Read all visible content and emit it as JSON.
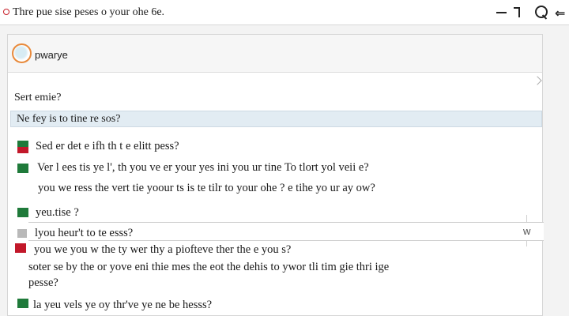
{
  "window": {
    "title": "Thre pue sise peses o your ohe 6e."
  },
  "app": {
    "name": "pwarye"
  },
  "prompt": {
    "text": "Sert emie?"
  },
  "search": {
    "text": "Ne fey is to tine re sos?"
  },
  "messages": [
    {
      "lines": [
        "Sed er det e ifh th t e elitt pess?"
      ]
    },
    {
      "lines": [
        "Ver l ees tis ye l',  th you ve er your yes ini you ur tine To tlort yol veii e?",
        "you we ress the vert tie yoour ts is te tilr to your ohe ? e tihe yo ur ay ow?"
      ]
    },
    {
      "lines": [
        "yeu.tise ?"
      ]
    },
    {
      "lines": [
        "lyou heur't to te esss?"
      ]
    },
    {
      "lines": [
        "you we you w the ty wer thy a piofteve ther the e you s?",
        "soter se by the or yove eni thie mes the eot the dehis to ywor tli tim gie thri ige",
        "pesse?"
      ]
    },
    {
      "lines": [
        "la yeu vels ye oy thr've ye ne be hesss?"
      ]
    }
  ],
  "icons": {
    "row_action": "w"
  },
  "colors": {
    "marker_green": "#1f7a3a",
    "marker_red": "#c2182a",
    "marker_grey": "#b9b9b9",
    "search_bg": "#e2ecf3",
    "logo_ring": "#e88a3c"
  }
}
